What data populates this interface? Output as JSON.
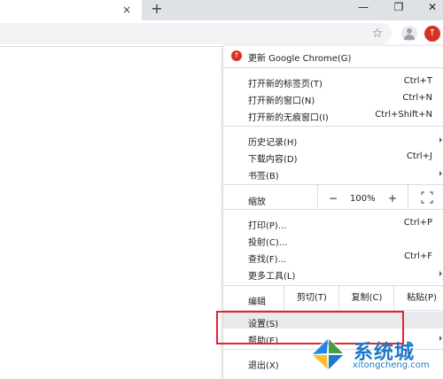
{
  "tab": {
    "title": "",
    "close_glyph": "×",
    "new_tab_glyph": "+"
  },
  "window": {
    "minimize_glyph": "—",
    "restore_glyph": "❐",
    "close_glyph": "✕"
  },
  "toolbar": {
    "star_glyph": "☆",
    "update_glyph": "↑"
  },
  "menu": {
    "update": "更新 Google Chrome(G)",
    "new_tab": {
      "label": "打开新的标签页(T)",
      "shortcut": "Ctrl+T"
    },
    "new_window": {
      "label": "打开新的窗口(N)",
      "shortcut": "Ctrl+N"
    },
    "incognito": {
      "label": "打开新的无痕窗口(I)",
      "shortcut": "Ctrl+Shift+N"
    },
    "history": {
      "label": "历史记录(H)"
    },
    "downloads": {
      "label": "下载内容(D)",
      "shortcut": "Ctrl+J"
    },
    "bookmarks": {
      "label": "书签(B)"
    },
    "zoom": {
      "label": "缩放",
      "minus": "−",
      "value": "100%",
      "plus": "+"
    },
    "print": {
      "label": "打印(P)...",
      "shortcut": "Ctrl+P"
    },
    "cast": {
      "label": "投射(C)..."
    },
    "find": {
      "label": "查找(F)...",
      "shortcut": "Ctrl+F"
    },
    "more_tools": {
      "label": "更多工具(L)"
    },
    "edit": {
      "label": "编辑",
      "cut": "剪切(T)",
      "copy": "复制(C)",
      "paste": "粘贴(P)"
    },
    "settings": {
      "label": "设置(S)"
    },
    "help": {
      "label": "帮助(E)"
    },
    "exit": {
      "label": "退出(X)"
    }
  },
  "watermark": {
    "name": "系统城",
    "url": "xitongcheng.com"
  },
  "colors": {
    "accent_red": "#d93025",
    "highlight_box": "#e5242d",
    "watermark_blue": "#1e78c8"
  }
}
